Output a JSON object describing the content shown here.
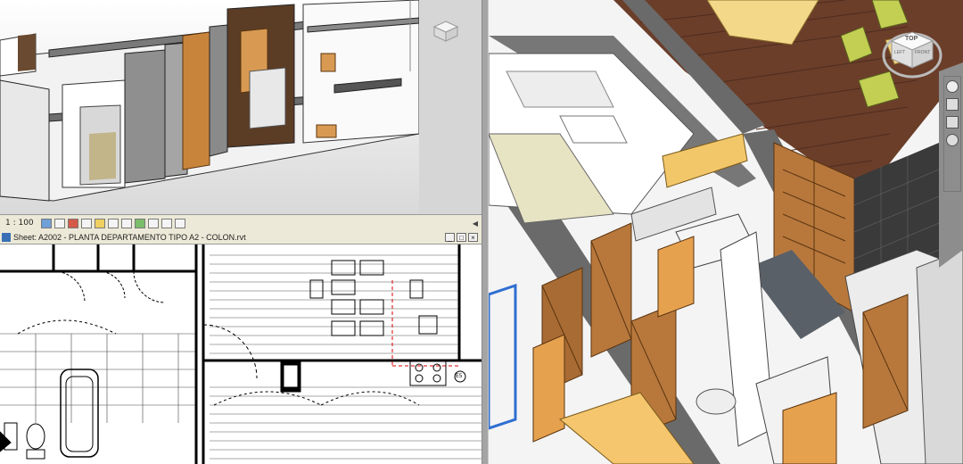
{
  "view_control_bar": {
    "scale": "1 : 100"
  },
  "sheet_window": {
    "title": "Sheet: A2002 - PLANTA DEPARTAMENTO TIPO A2 - COLON.rvt",
    "buttons": [
      "_",
      "□",
      "×"
    ]
  },
  "viewcube": {
    "face_label": "TOP",
    "compass_labels": [
      "LEFT",
      "FRONT"
    ]
  },
  "icons": [
    "viewcube-icon",
    "navigation-wheel-icon",
    "zoom-icon",
    "pan-icon",
    "orbit-icon",
    "sun-path-icon",
    "shadows-icon",
    "crop-icon",
    "hide-isolate-icon",
    "reveal-hidden-icon"
  ],
  "tag_label": "E5"
}
